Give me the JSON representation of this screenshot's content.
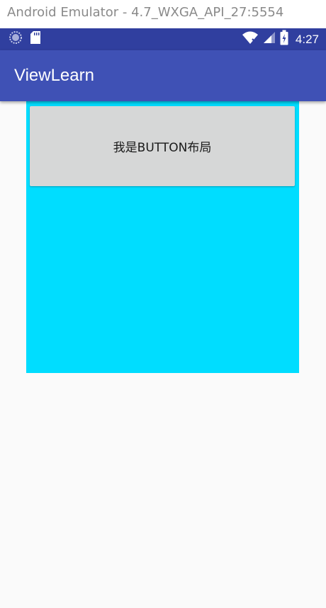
{
  "window": {
    "title": "Android Emulator - 4.7_WXGA_API_27:5554"
  },
  "status_bar": {
    "time": "4:27",
    "left_icons": [
      "sync-icon",
      "sd-card-icon"
    ],
    "right_icons": [
      "wifi-icon",
      "cell-signal-icon",
      "battery-charging-icon"
    ]
  },
  "app_bar": {
    "title": "ViewLearn"
  },
  "main": {
    "button_label": "我是BUTTON布局"
  },
  "colors": {
    "status_bar": "#303f9f",
    "app_bar": "#3f51b5",
    "layout_background": "#00ddff",
    "button_background": "#d6d7d7",
    "screen_background": "#fafafa"
  }
}
